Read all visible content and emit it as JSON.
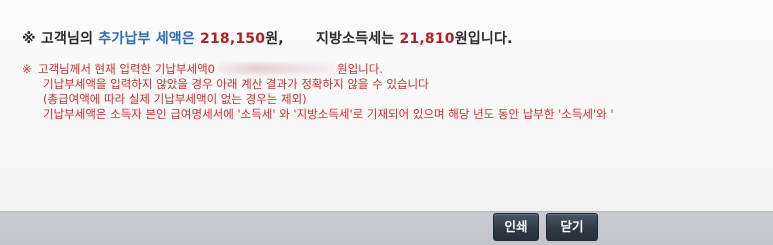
{
  "summary": {
    "bullet": "※",
    "prefix": "고객님의",
    "label_highlight": "추가납부 세액은",
    "national_amount": "218,150",
    "won_suffix_1": "원,",
    "local_label": "지방소득세는",
    "local_amount": "21,810",
    "won_suffix_2": "원입니다."
  },
  "notice": {
    "mark": "※",
    "line1_before": "고객님께서 현재 입력한 기납부세액0",
    "line1_after": "원입니다.",
    "line2": "기납부세액을 입력하지 않았을 경우 아래 계산 결과가 정확하지 않을 수 있습니다",
    "line3": "(총급여액에 따라 실제 기납부세액이 없는 경우는 제외)",
    "line4": "기납부세액은 소득자 본인 급여명세서에 '소득세' 와 '지방소득세'로 기재되어 있으며 해당 년도 동안 납부한 '소득세'와 '"
  },
  "buttons": {
    "print": "인쇄",
    "close": "닫기"
  },
  "colors": {
    "highlight_blue": "#2e6db6",
    "amount_red": "#b41e2a",
    "notice_red": "#c9302c",
    "button_dark": "#2f3a46"
  }
}
